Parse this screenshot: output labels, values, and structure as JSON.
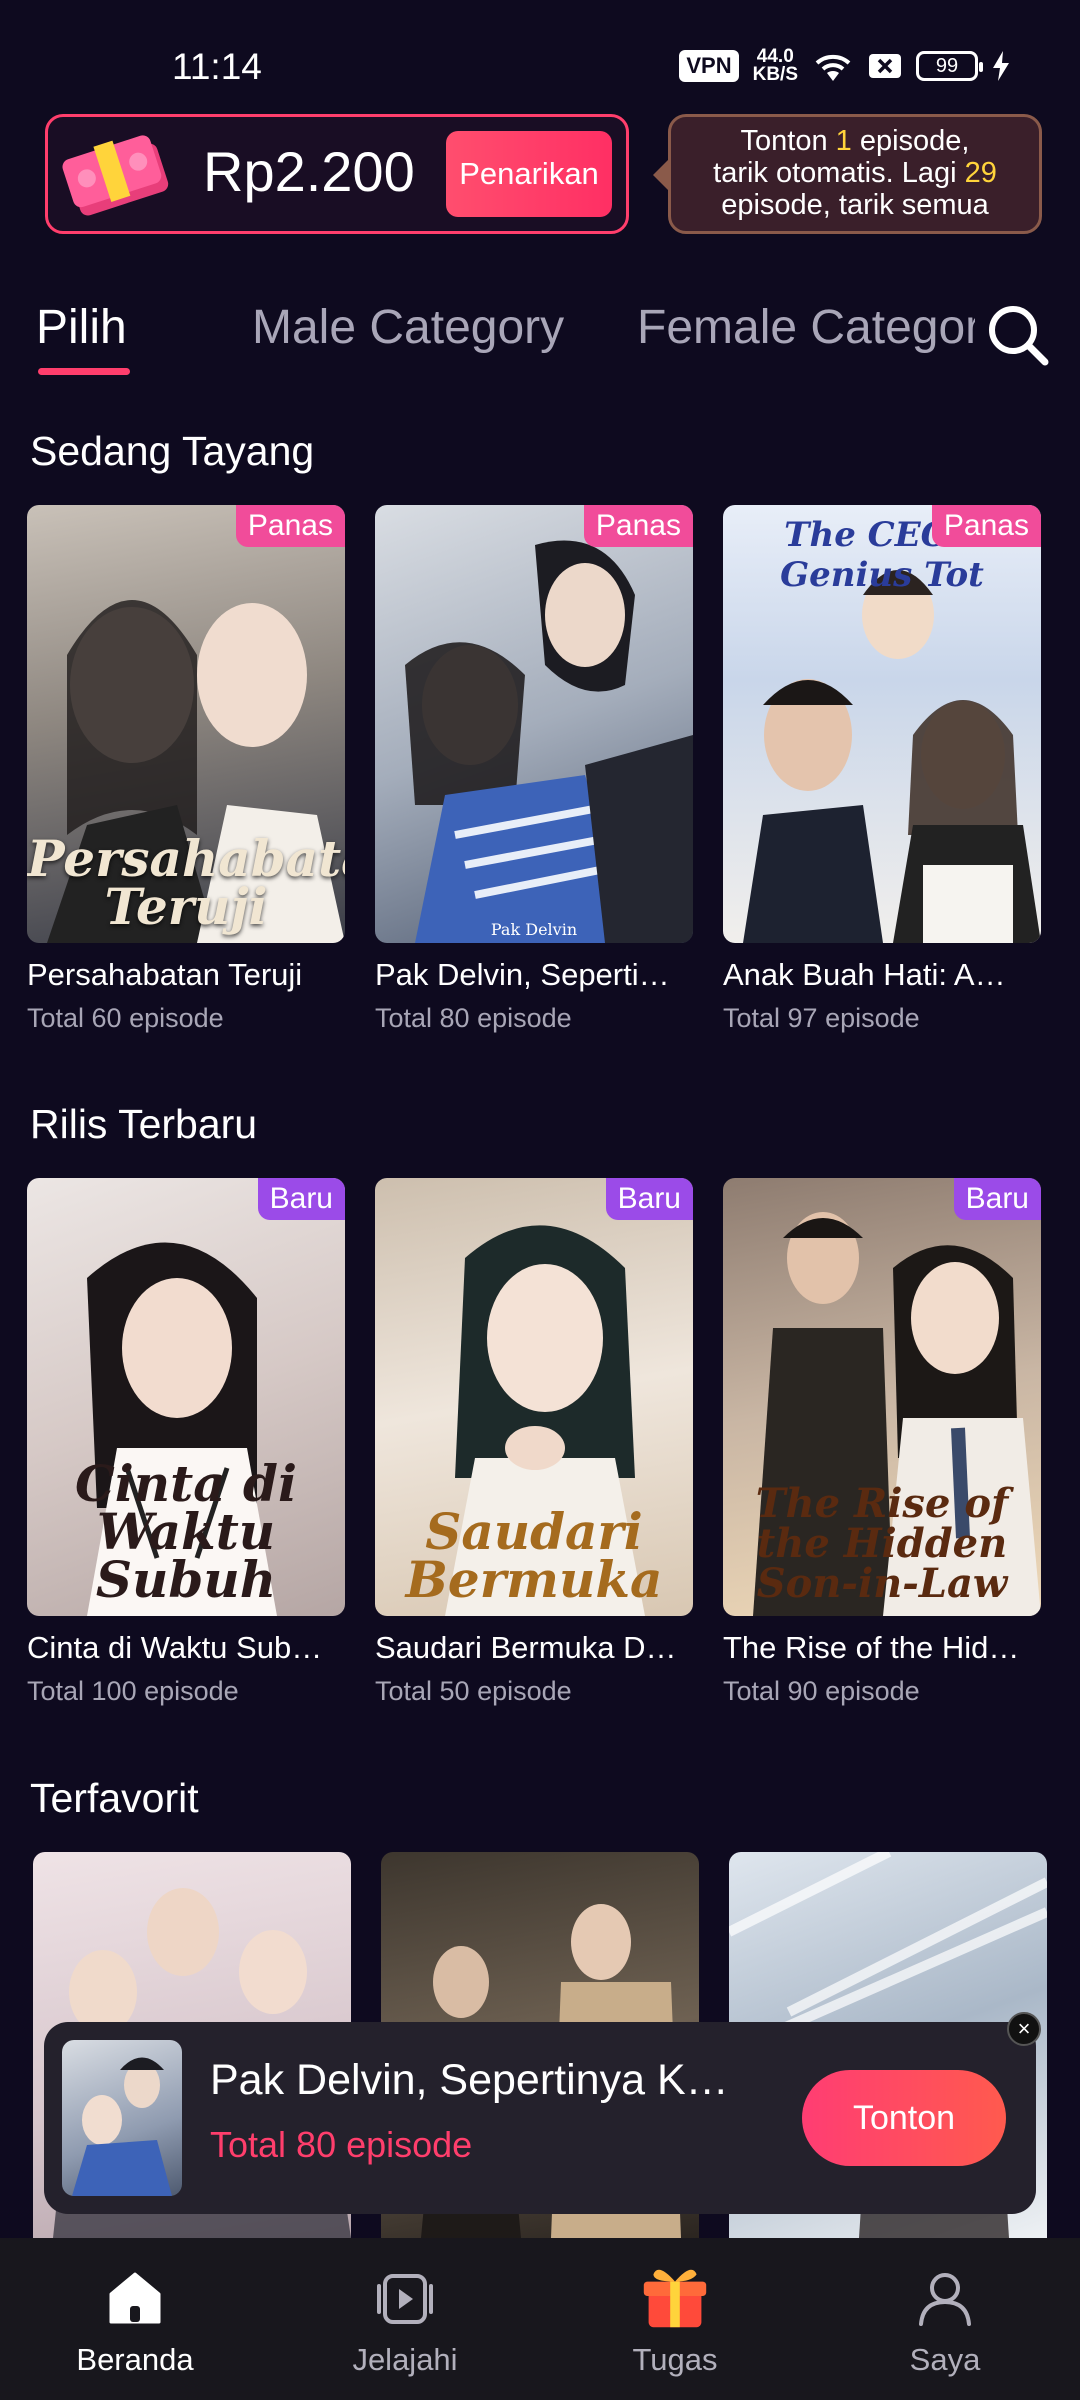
{
  "status_bar": {
    "time": "11:14",
    "vpn": "VPN",
    "speed_value": "44.0",
    "speed_unit": "KB/S",
    "battery": "99"
  },
  "reward": {
    "amount": "Rp2.200",
    "withdraw_label": "Penarikan",
    "tooltip": {
      "line1_pre": "Tonton ",
      "line1_num": "1",
      "line1_post": " episode,",
      "line2_pre": "tarik otomatis. Lagi ",
      "line2_num": "29",
      "line3": "episode, tarik semua"
    }
  },
  "tabs": [
    {
      "label": "Pilih",
      "active": true
    },
    {
      "label": "Male Category",
      "active": false
    },
    {
      "label": "Female Category",
      "active": false
    }
  ],
  "sections": [
    {
      "title": "Sedang Tayang",
      "items": [
        {
          "title": "Persahabatan Teruji",
          "episodes": "Total 60 episode",
          "badge": "Panas",
          "poster_text": "Persahabatan Teruji"
        },
        {
          "title": "Pak Delvin, Seperti…",
          "episodes": "Total 80 episode",
          "badge": "Panas",
          "poster_text": "Pak Delvin"
        },
        {
          "title": "Anak Buah Hati: A…",
          "episodes": "Total 97 episode",
          "badge": "Panas",
          "poster_text": "The CEO's Genius Tot"
        }
      ]
    },
    {
      "title": "Rilis Terbaru",
      "items": [
        {
          "title": "Cinta di Waktu Sub…",
          "episodes": "Total 100 episode",
          "badge": "Baru",
          "poster_text": "Cinta di Waktu Subuh"
        },
        {
          "title": "Saudari Bermuka D…",
          "episodes": "Total 50 episode",
          "badge": "Baru",
          "poster_text": "Saudari Bermuka"
        },
        {
          "title": "The Rise of the Hid…",
          "episodes": "Total 90 episode",
          "badge": "Baru",
          "poster_text": "The Rise of the Hidden Son-in-Law"
        }
      ]
    },
    {
      "title": "Terfavorit",
      "items": []
    }
  ],
  "mini_player": {
    "title": "Pak Delvin, Sepertinya K…",
    "episodes": "Total 80 episode",
    "watch_label": "Tonton",
    "close": "×"
  },
  "bottom_nav": [
    {
      "label": "Beranda",
      "icon": "home-icon",
      "active": true
    },
    {
      "label": "Jelajahi",
      "icon": "play-icon",
      "active": false
    },
    {
      "label": "Tugas",
      "icon": "gift-icon",
      "active": false
    },
    {
      "label": "Saya",
      "icon": "user-icon",
      "active": false
    }
  ],
  "colors": {
    "background": "#0e0a1f",
    "accent": "#ff3e6c",
    "badge_hot": "#f14c9a",
    "badge_new": "#9b4be8",
    "highlight": "#ffd43b"
  }
}
